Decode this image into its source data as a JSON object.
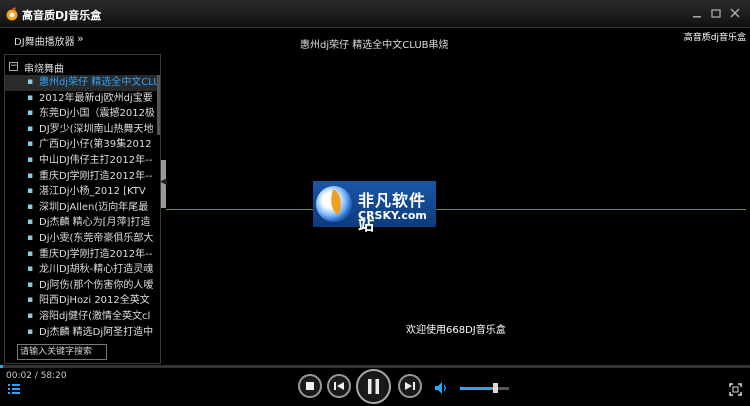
{
  "window": {
    "title": "高音质DJ音乐盒",
    "minimize_icon": "minimize-icon",
    "restore_icon": "restore-icon",
    "close_icon": "close-icon"
  },
  "header": {
    "playlist_toggle": "DJ舞曲播放器",
    "chevron": "»",
    "now_playing": "惠州dj荣仔 精选全中文CLUB串烧",
    "brand": "高音质dj音乐盒"
  },
  "playlist": {
    "group_label": "串烧舞曲",
    "collapse_symbol": "−",
    "selected_index": 0,
    "tracks": [
      "惠州dj荣仔 精选全中文CLUB",
      "2012年最新dj欧州dj宝要",
      "东莞Dj小国（震撼2012极",
      "DJ罗少(深圳南山热舞天地",
      "广西Dj小仔(第39集2012",
      "中山DJ伟仔主打2012年--",
      "重庆DJ学刚打造2012年--",
      "湛江Dj小杨_2012 [KTV",
      "深圳DjAllen(迈向年尾最",
      "Dj杰麟 精心为[月萍]打造",
      "Dj小雯(东莞帝豪俱乐部大",
      "重庆DJ学刚打造2012年--",
      "龙川DJ胡秋-精心打造灵魂",
      "Dj阿伤(那个伤害你的人嗳",
      "阳西DjHozi 2012全英文",
      "溶阳dj健仔(激情全英文cl",
      "Dj杰麟 精选Dj阿圣打造中"
    ],
    "search_placeholder": "请输入关键字搜索"
  },
  "player": {
    "welcome": "欢迎使用668DJ音乐盒",
    "elapsed": "00:02",
    "total": "58:20",
    "time_text": "00:02 / 58:20",
    "progress_fraction": 0.0006,
    "volume_fraction": 0.72
  },
  "watermark": {
    "name": "非凡软件站",
    "url": "CRSKY.com"
  },
  "colors": {
    "accent": "#2aa6ff",
    "background": "#000000",
    "visualizer": "#6a8f1e"
  }
}
